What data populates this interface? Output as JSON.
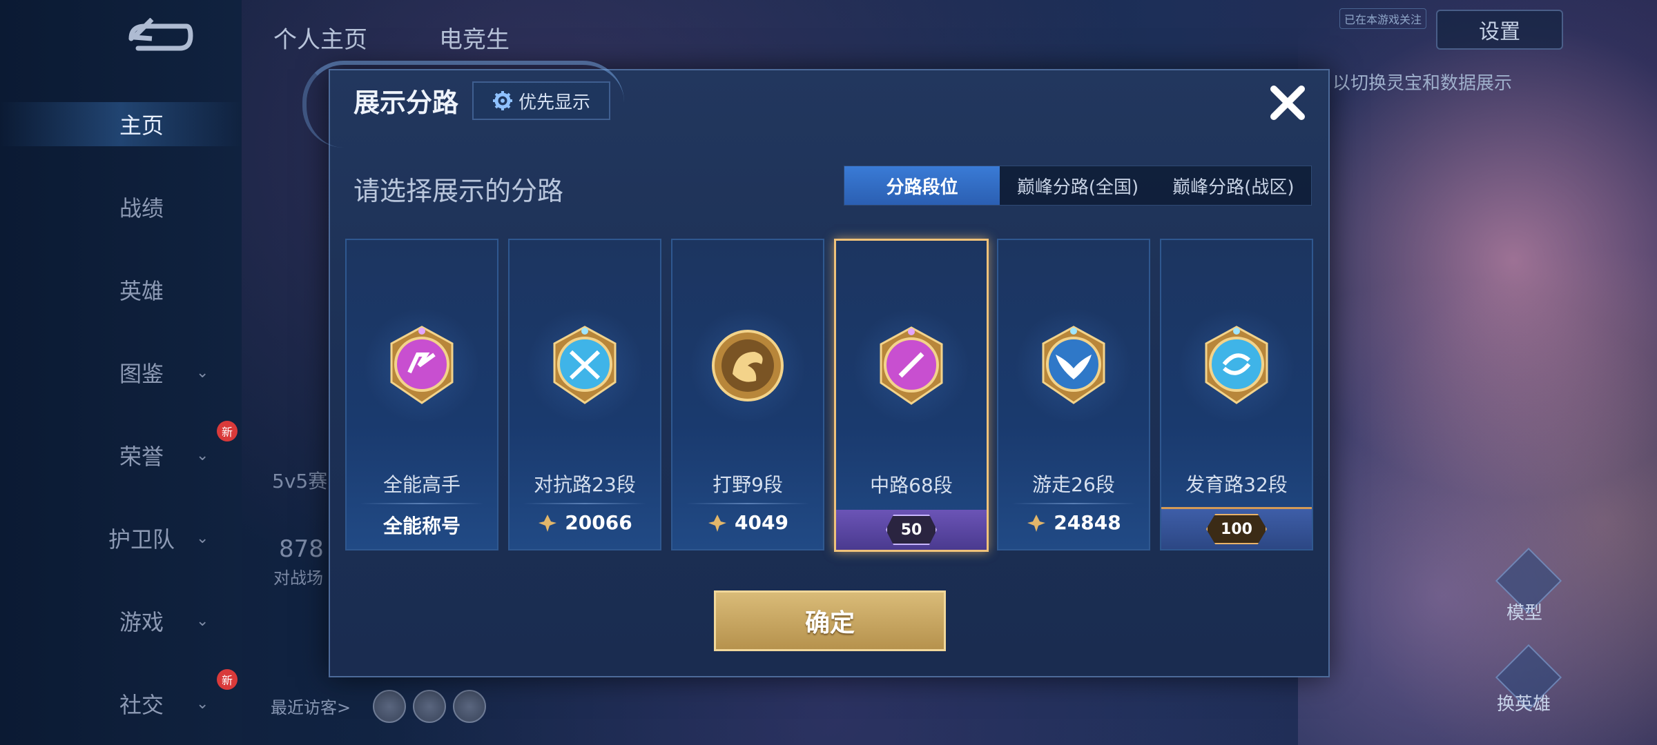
{
  "background": {
    "top_tabs": [
      "个人主页",
      "电竞生"
    ],
    "settings_label": "设置",
    "top_badge": "已在本游戏关注",
    "top_hint": "以切换灵宝和数据展示",
    "sidebar": {
      "items": [
        {
          "label": "主页",
          "active": true
        },
        {
          "label": "战绩"
        },
        {
          "label": "英雄"
        },
        {
          "label": "图鉴",
          "chevron": true
        },
        {
          "label": "荣誉",
          "chevron": true,
          "new": "新"
        },
        {
          "label": "护卫队",
          "chevron": true
        },
        {
          "label": "游戏",
          "chevron": true
        },
        {
          "label": "社交",
          "chevron": true,
          "new": "新"
        }
      ]
    },
    "side_texts": [
      "5v5赛",
      "878",
      "对战场"
    ],
    "visitors_label": "最近访客>",
    "right_buttons": [
      "模型",
      "换英雄"
    ]
  },
  "dialog": {
    "title": "展示分路",
    "priority_button": "优先显示",
    "subtitle": "请选择展示的分路",
    "tabs": [
      {
        "label": "分路段位",
        "active": true
      },
      {
        "label": "巅峰分路(全国)"
      },
      {
        "label": "巅峰分路(战区)"
      }
    ],
    "cards": [
      {
        "role": "全能高手",
        "value": "全能称号",
        "icon": "all-round-badge-icon",
        "color": "#c84fd0",
        "selected": false,
        "footer": "text"
      },
      {
        "role": "对抗路23段",
        "value": "20066",
        "icon": "clash-lane-badge-icon",
        "color": "#3fb4e8",
        "selected": false,
        "footer": "peak"
      },
      {
        "role": "打野9段",
        "value": "4049",
        "icon": "jungle-badge-icon",
        "color": "#d8a24a",
        "selected": false,
        "footer": "peak"
      },
      {
        "role": "中路68段",
        "value": "50",
        "icon": "mid-lane-badge-icon",
        "color": "#c84fd0",
        "selected": true,
        "footer": "rank-purple"
      },
      {
        "role": "游走26段",
        "value": "24848",
        "icon": "roam-badge-icon",
        "color": "#3fa4e8",
        "selected": false,
        "footer": "peak"
      },
      {
        "role": "发育路32段",
        "value": "100",
        "icon": "farm-lane-badge-icon",
        "color": "#3fb4e8",
        "selected": false,
        "footer": "rank-gold"
      }
    ],
    "confirm_button": "确定"
  }
}
